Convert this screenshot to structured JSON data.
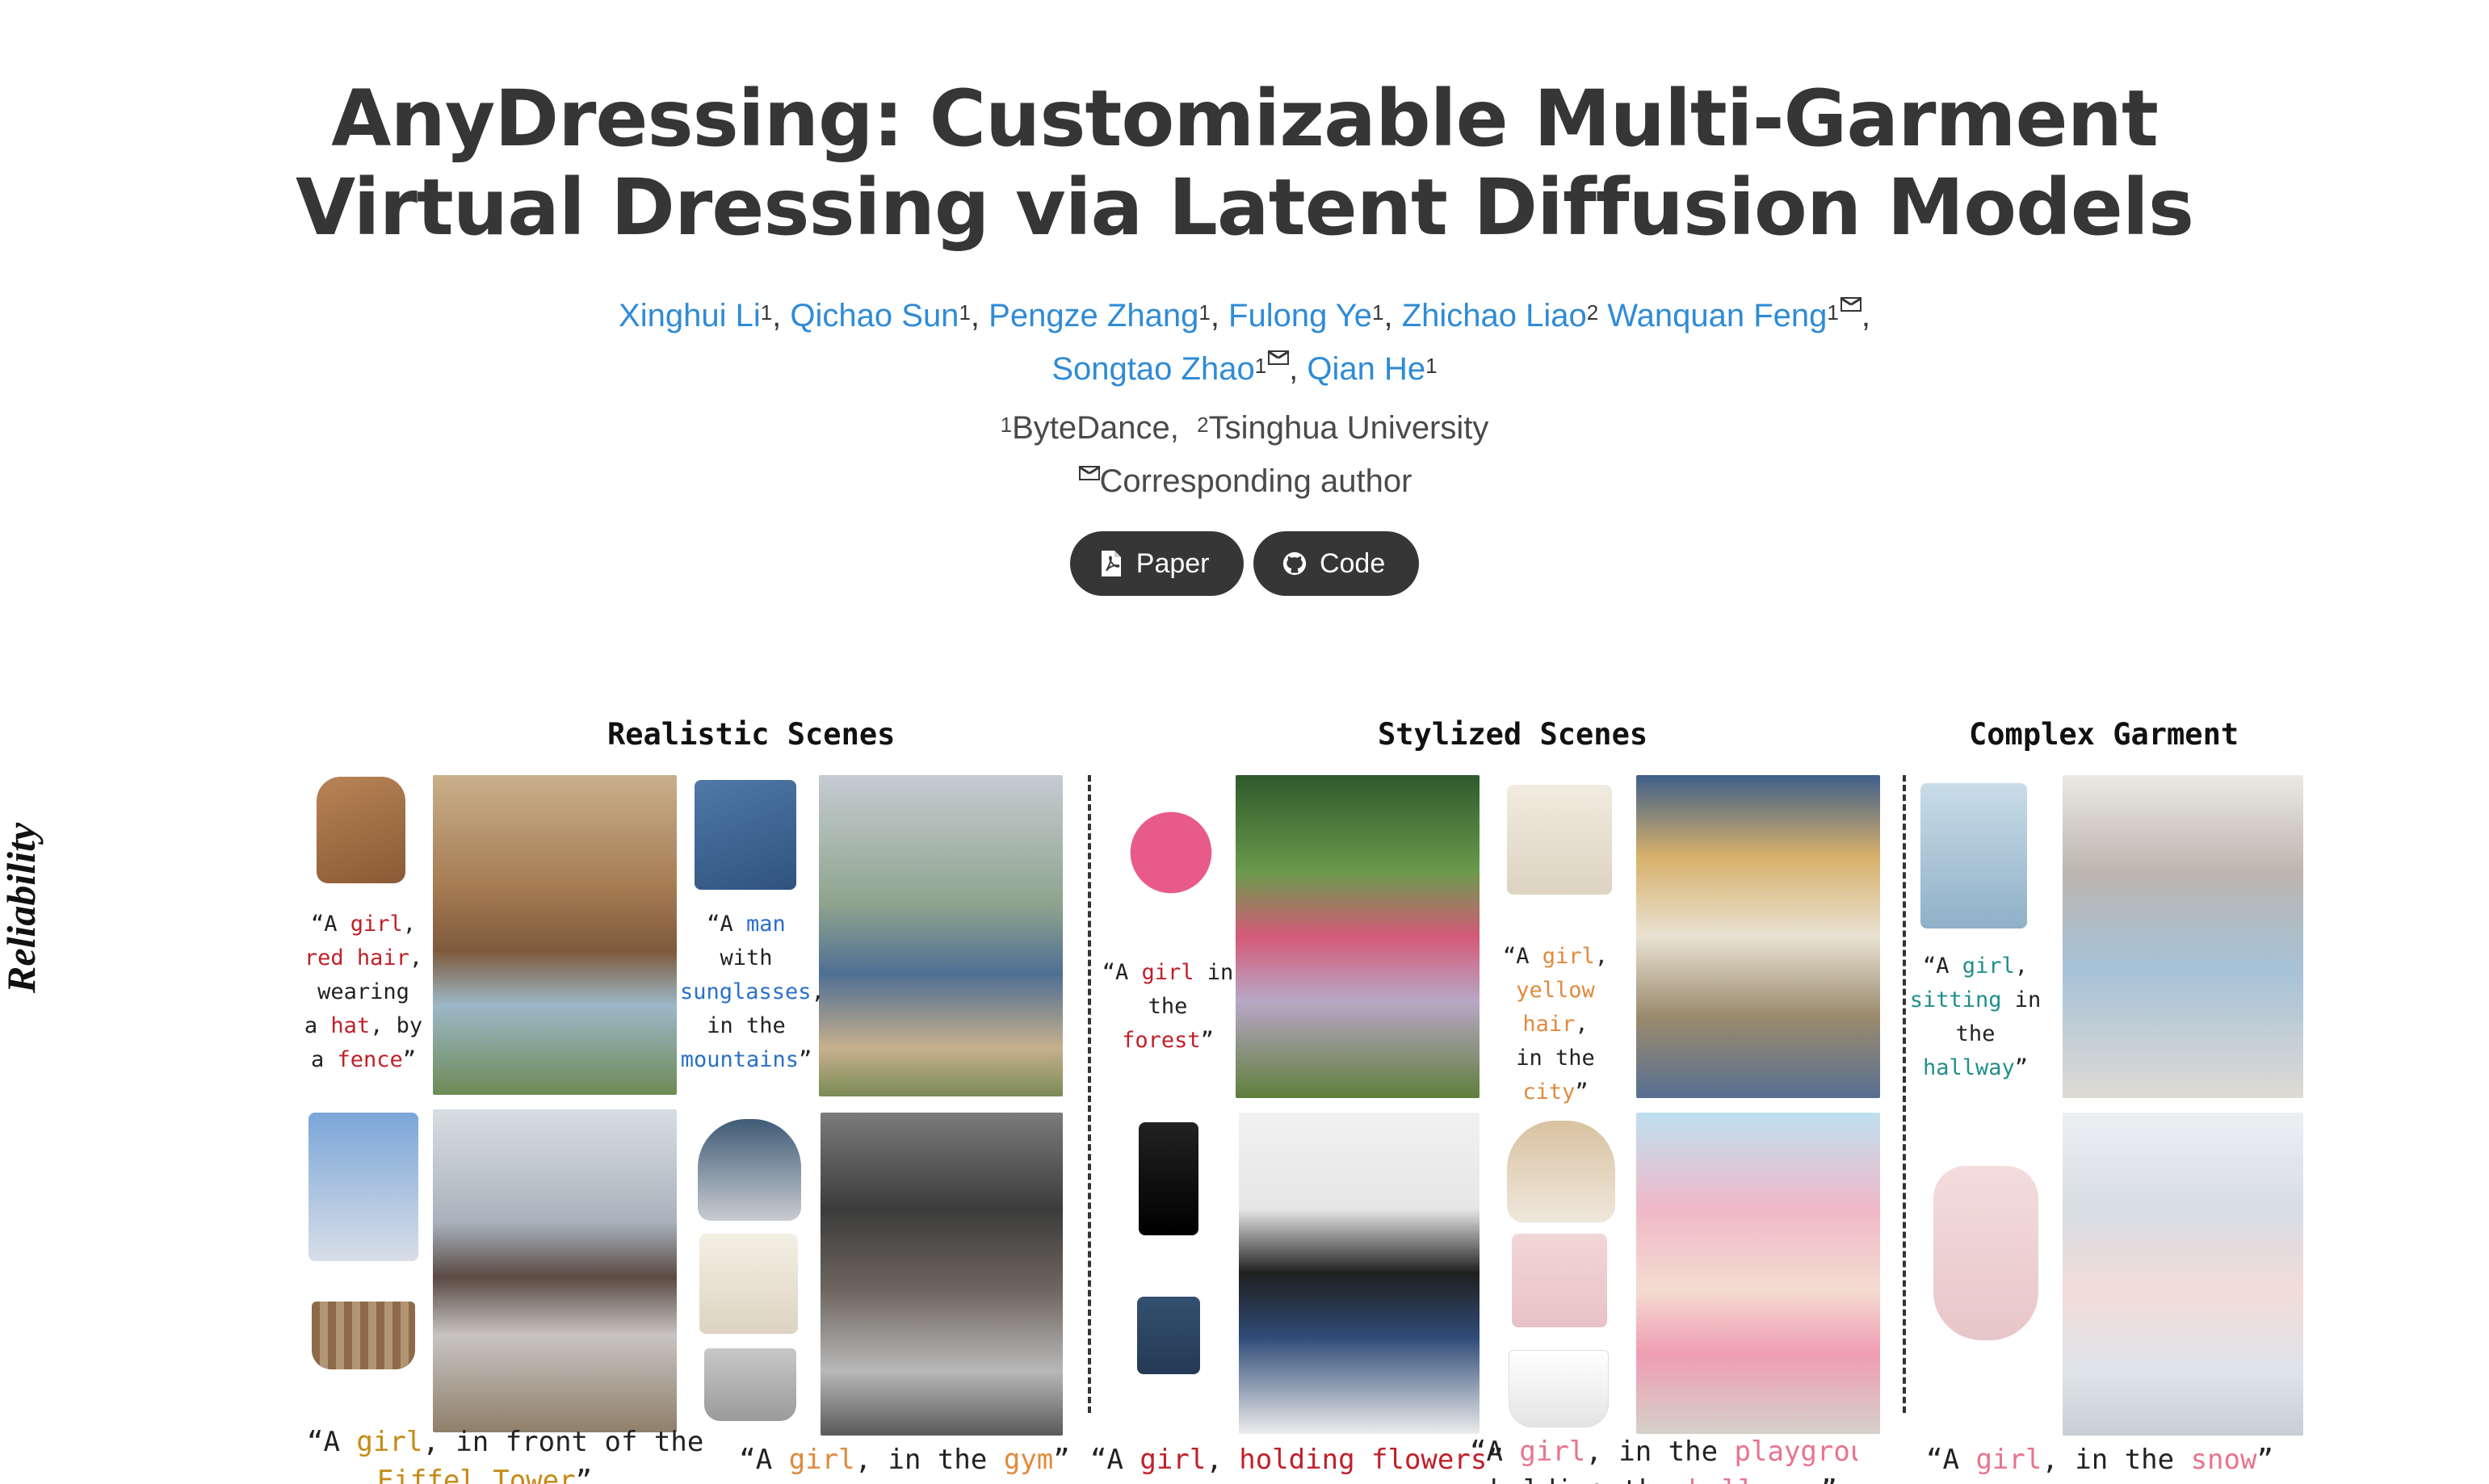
{
  "title": {
    "line1": "AnyDressing: Customizable Multi-Garment",
    "line2": "Virtual Dressing via Latent Diffusion Models"
  },
  "authors": [
    {
      "name": "Xinghui Li",
      "sup": "1"
    },
    {
      "name": "Qichao Sun",
      "sup": "1"
    },
    {
      "name": "Pengze Zhang",
      "sup": "1"
    },
    {
      "name": "Fulong Ye",
      "sup": "1"
    },
    {
      "name": "Zhichao Liao",
      "sup": "2"
    },
    {
      "name": "Wanquan Feng",
      "sup": "1"
    },
    {
      "name": "Songtao Zhao",
      "sup": "1"
    },
    {
      "name": "Qian He",
      "sup": "1"
    }
  ],
  "affiliations": {
    "a1_sup": "1",
    "a1": "ByteDance,",
    "a2_sup": "2",
    "a2": "Tsinghua University"
  },
  "corresponding": "Corresponding author",
  "buttons": {
    "paper": "Paper",
    "code": "Code"
  },
  "figure": {
    "side_label": "Reliability",
    "sections": {
      "realistic": "Realistic Scenes",
      "stylized": "Stylized Scenes",
      "complex": "Complex Garment"
    },
    "captions": {
      "c1": [
        "“A ",
        "girl",
        ",",
        "red hair",
        ",",
        "wearing",
        "a ",
        "hat",
        ", by",
        "a ",
        "fence",
        "”"
      ],
      "c2": [
        "“A ",
        "man",
        "with",
        "sunglasses",
        ",",
        "in the",
        "mountains",
        "”"
      ],
      "c3": [
        "“A ",
        "girl",
        " in",
        "the ",
        "forest",
        "”"
      ],
      "c4": [
        "“A ",
        "girl",
        ",",
        "yellow hair",
        ",",
        "in the ",
        "city",
        "”"
      ],
      "c5": [
        "“A ",
        "girl",
        ",",
        "sitting",
        " in",
        "the",
        "hallway",
        "”"
      ],
      "b1": [
        "“A ",
        "girl",
        ", in front of the",
        "Eiffel Tower",
        "”"
      ],
      "b2": [
        "“A ",
        "girl",
        ", in the ",
        "gym",
        "”"
      ],
      "b3": [
        "“A ",
        "girl",
        ", ",
        "holding flowers",
        "”"
      ],
      "b4": [
        "“A ",
        "girl",
        ", in the ",
        "playground,",
        "holding the ",
        "balloons",
        "”"
      ],
      "b5": [
        "“A ",
        "girl",
        ", in the ",
        "snow",
        "”"
      ]
    }
  },
  "colors": {
    "title": "#363636",
    "author_link": "#2f8bd6",
    "button_bg": "#363636",
    "red": "#c0202a",
    "blue": "#2a6fc9",
    "gold": "#c48a14",
    "orange": "#e08a3c",
    "teal": "#1f8f8a",
    "pink": "#e8748f"
  }
}
